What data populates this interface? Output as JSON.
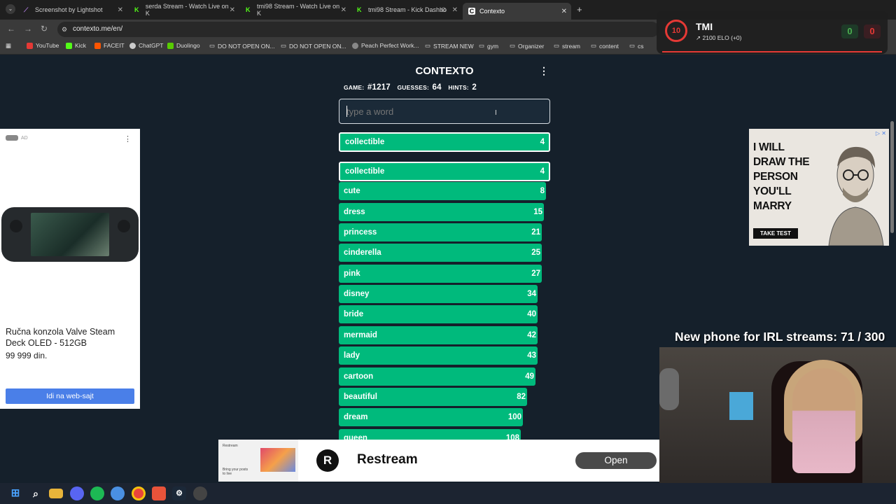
{
  "browser": {
    "tabs": [
      {
        "label": "Screenshot by Lightshot"
      },
      {
        "label": "serda Stream - Watch Live on K"
      },
      {
        "label": "tmi98 Stream - Watch Live on K"
      },
      {
        "label": "tmi98 Stream - Kick Dashbo"
      },
      {
        "label": "Contexto"
      }
    ],
    "url": "contexto.me/en/",
    "bookmarks": [
      "YouTube",
      "Kick",
      "FACEIT",
      "ChatGPT",
      "Duolingo",
      "DO NOT OPEN ON...",
      "DO NOT OPEN ON...",
      "Peach Perfect Work...",
      "STREAM NEW",
      "gym",
      "Organizer",
      "stream",
      "content",
      "cs"
    ]
  },
  "game": {
    "title": "CONTEXTO",
    "game_label": "GAME:",
    "game_number": "#1217",
    "guesses_label": "GUESSES:",
    "guesses": "64",
    "hints_label": "HINTS:",
    "hints": "2",
    "input_placeholder": "type a word",
    "last_guess": {
      "word": "collectible",
      "rank": 4
    },
    "guesses_list": [
      {
        "word": "collectible",
        "rank": 4,
        "fill": 0.99
      },
      {
        "word": "cute",
        "rank": 8,
        "fill": 0.99
      },
      {
        "word": "dress",
        "rank": 15,
        "fill": 0.98
      },
      {
        "word": "princess",
        "rank": 21,
        "fill": 0.97
      },
      {
        "word": "cinderella",
        "rank": 25,
        "fill": 0.97
      },
      {
        "word": "pink",
        "rank": 27,
        "fill": 0.97
      },
      {
        "word": "disney",
        "rank": 34,
        "fill": 0.95
      },
      {
        "word": "bride",
        "rank": 40,
        "fill": 0.95
      },
      {
        "word": "mermaid",
        "rank": 42,
        "fill": 0.95
      },
      {
        "word": "lady",
        "rank": 43,
        "fill": 0.95
      },
      {
        "word": "cartoon",
        "rank": 49,
        "fill": 0.94
      },
      {
        "word": "beautiful",
        "rank": 82,
        "fill": 0.9
      },
      {
        "word": "dream",
        "rank": 100,
        "fill": 0.88
      },
      {
        "word": "queen",
        "rank": 108,
        "fill": 0.87
      }
    ]
  },
  "ad_left": {
    "tag": "AD",
    "product": "Ručna konzola Valve Steam Deck OLED - 512GB",
    "price": "99 999 din.",
    "cta": "Idi na web-sajt"
  },
  "ad_right": {
    "headline": "I WILL DRAW THE PERSON YOU'LL MARRY",
    "cta": "TAKE TEST"
  },
  "banner": {
    "brand": "Restream",
    "thumb_brand": "Restream",
    "thumb_text": "Bring your posts to live",
    "open": "Open"
  },
  "overlay": {
    "faceit_level": "10",
    "player": "TMI",
    "elo": "↗ 2100 ELO (+0)",
    "wins": "0",
    "losses": "0",
    "goal": "New phone for IRL streams:  71 / 300"
  },
  "colors": {
    "accent": "#00ba7c",
    "page_bg": "#15202b"
  }
}
